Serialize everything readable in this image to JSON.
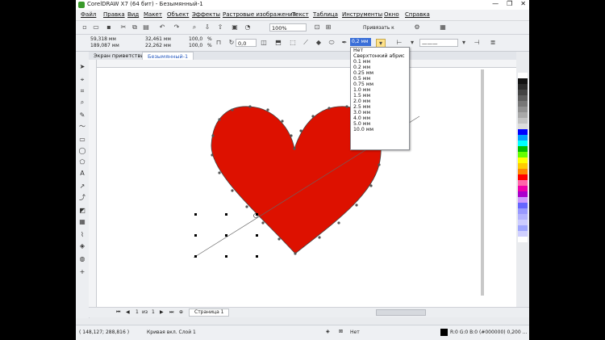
{
  "window": {
    "title": "CorelDRAW X7 (64 бит) - Безымянный-1",
    "min": "—",
    "max": "❐",
    "close": "✕"
  },
  "menu": [
    "Файл",
    "Правка",
    "Вид",
    "Макет",
    "Объект",
    "Эффекты",
    "Растровые изображения",
    "Текст",
    "Таблица",
    "Инструменты",
    "Окно",
    "Справка"
  ],
  "toolbar": {
    "zoom": "100%",
    "snap_label": "Привязать к"
  },
  "props": {
    "x": "59,318 мм",
    "y": "189,087 мм",
    "w": "32,461 мм",
    "h": "22,262 мм",
    "scale_w": "100,0",
    "scale_h": "100,0",
    "pct": "%",
    "angle": "0,0",
    "outline_width": "0,2 мм"
  },
  "outline_dropdown": {
    "options": [
      "Нет",
      "Сверхтонкий абрис",
      "0.1 мм",
      "0.2 мм",
      "0.25 мм",
      "0.5 мм",
      "0.75 мм",
      "1.0 мм",
      "1.5 мм",
      "2.0 мм",
      "2.5 мм",
      "3.0 мм",
      "4.0 мм",
      "5.0 мм",
      "10.0 мм"
    ]
  },
  "tabs": {
    "welcome": "Экран приветствия",
    "doc": "Безымянный-1"
  },
  "page_nav": {
    "current": "1",
    "of": "из",
    "total": "1",
    "page_tab": "Страница 1"
  },
  "status": {
    "coords": "( 148,127; 288,816 )",
    "object_info": "Кривая вкл. Слой 1",
    "fill_none": "Нет",
    "outline_info": "R:0 G:0 B:0 (#000000)  0,200 ..."
  },
  "colors": {
    "heart_fill": "#dd1100",
    "selection": "#3a6fd8"
  },
  "palette": [
    "#ffffff",
    "#111111",
    "#2a2a2a",
    "#444444",
    "#5d5d5d",
    "#777777",
    "#909090",
    "#a9a9a9",
    "#c3c3c3",
    "#dcdcdc",
    "#0000ff",
    "#00a0ff",
    "#00ffff",
    "#00c000",
    "#66ff00",
    "#ffff00",
    "#ffcc00",
    "#ff8800",
    "#ff0000",
    "#ff66aa",
    "#ee00aa",
    "#aa00cc",
    "#cc99ff",
    "#6666ff",
    "#9999ff",
    "#b3b3ff",
    "#ccccff",
    "#9fa6ff",
    "#d0d0ff",
    "#ffffff"
  ]
}
